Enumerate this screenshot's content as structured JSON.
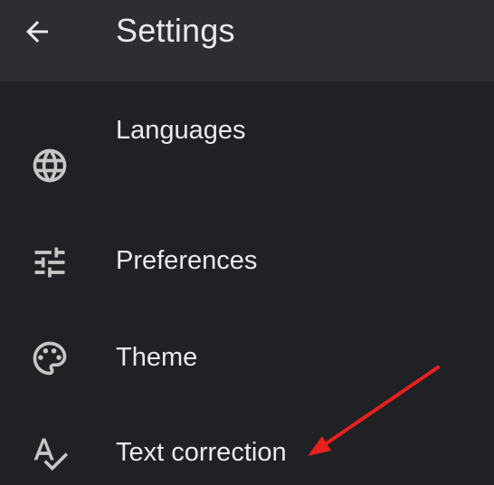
{
  "header": {
    "title": "Settings",
    "back_icon": "arrow-back-icon"
  },
  "items": [
    {
      "label": "Languages",
      "icon": "globe-icon"
    },
    {
      "label": "Preferences",
      "icon": "tune-icon"
    },
    {
      "label": "Theme",
      "icon": "palette-icon"
    },
    {
      "label": "Text correction",
      "icon": "spellcheck-icon"
    }
  ],
  "colors": {
    "background": "#202124",
    "app_bar": "#2d2e31",
    "text": "#e8eaed",
    "icon": "#c4c7c5",
    "annotation": "#e8201e"
  }
}
